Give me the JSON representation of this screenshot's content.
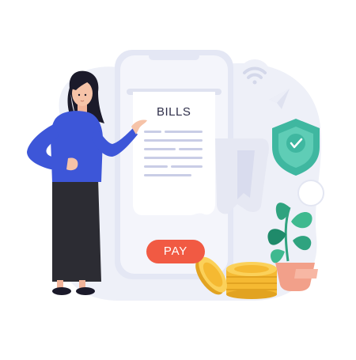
{
  "bill": {
    "title": "BILLS",
    "pay_label": "PAY"
  },
  "colors": {
    "background_blob": "#eef0f8",
    "phone_body": "#e9ebf6",
    "phone_screen": "#f4f5fb",
    "paper": "#ffffff",
    "accent_blue": "#3d56d8",
    "pay_button": "#f15a43",
    "shield": "#3fb7a0",
    "coin": "#f5b932",
    "plant": "#2fa37f",
    "pot": "#f2a08a",
    "skirt": "#2c2c33"
  },
  "icons": [
    "wifi-icon",
    "paper-plane-icon",
    "shield-check-icon",
    "coin-stack-icon",
    "plant-icon"
  ]
}
